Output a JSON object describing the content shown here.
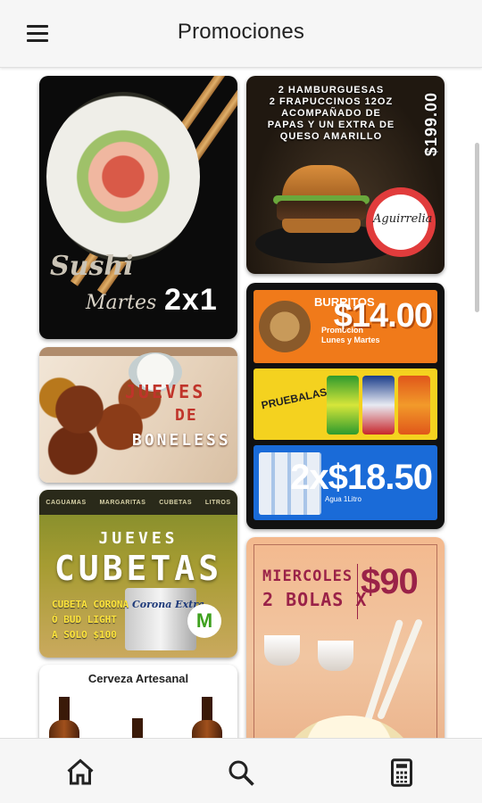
{
  "app": {
    "title": "Promociones"
  },
  "cards": {
    "sushi": {
      "word": "Sushi",
      "day": "Martes",
      "promo": "2x1"
    },
    "burger": {
      "lines": [
        "2 HAMBURGUESAS",
        "2 FRAPUCCINOS 12OZ",
        "ACOMPAÑADO DE",
        "PAPAS Y UN EXTRA DE",
        "QUESO AMARILLO"
      ],
      "price": "$199.00",
      "badge": "Aguirrelia"
    },
    "burritos": {
      "name": "BURRITOS",
      "sub": "Promocion Lunes y Martes",
      "price": "$14.00",
      "pruebalas": "PRUEBALAS!!",
      "note": "Agua 1Litro",
      "combo_price": "2x$18.50"
    },
    "boneless": {
      "t1": "JUEVES",
      "t2": "DE",
      "t3": "BONELESS"
    },
    "cubetas": {
      "menu": [
        "CAGUAMAS",
        "MARGARITAS",
        "CUBETAS",
        "LITROS"
      ],
      "title1": "JUEVES",
      "title2": "CUBETAS",
      "offer": [
        "CUBETA CORONA",
        "Ó BUD LIGHT",
        "A SOLO $100"
      ],
      "brand": "Corona Extra",
      "logo": "M"
    },
    "cerveza": {
      "title": "Cerveza Artesanal"
    },
    "miercoles": {
      "line1": "MIERCOLES",
      "line2": "2 BOLAS X",
      "price": "$90"
    }
  },
  "nav": {
    "items": [
      "home-icon",
      "search-icon",
      "calculator-icon"
    ]
  }
}
